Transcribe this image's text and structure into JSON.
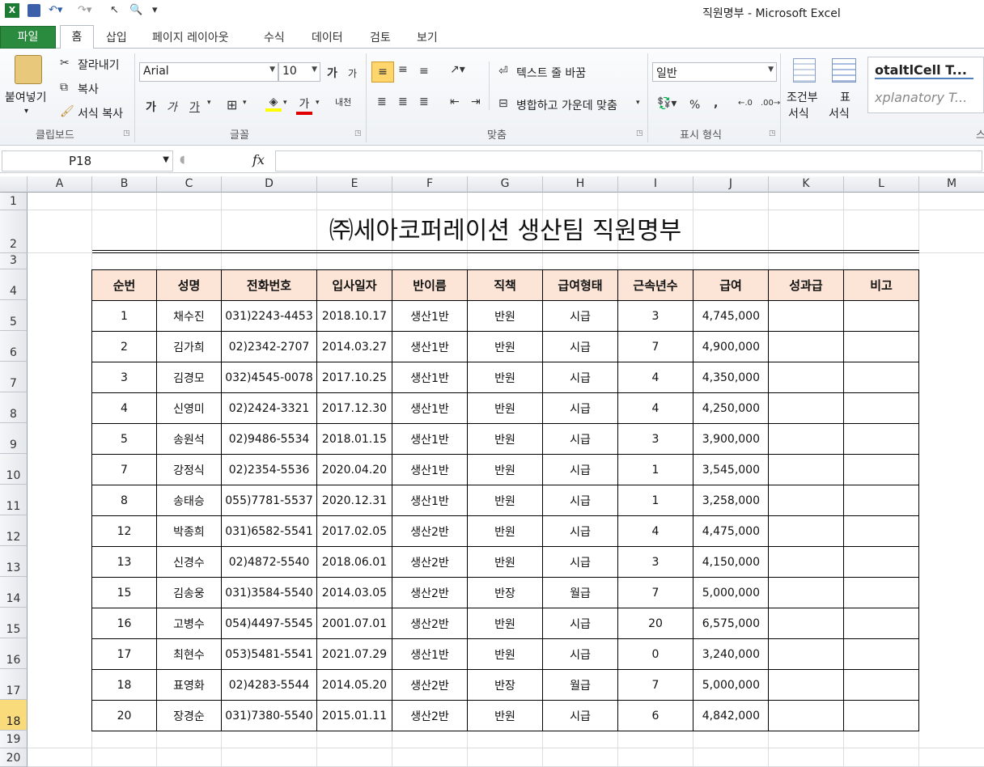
{
  "window": {
    "title": "직원명부  -  Microsoft Excel"
  },
  "quick_access": {
    "icons": [
      "excel-logo-icon",
      "save-icon",
      "undo-icon",
      "redo-icon",
      "pointer-icon",
      "print-preview-icon",
      "customize-qat-icon"
    ]
  },
  "tabs": [
    "파일",
    "홈",
    "삽입",
    "페이지 레이아웃",
    "수식",
    "데이터",
    "검토",
    "보기"
  ],
  "ribbon": {
    "clipboard": {
      "paste": "붙여넣기",
      "cut": "잘라내기",
      "copy": "복사",
      "format_painter": "서식 복사",
      "label": "클립보드"
    },
    "font": {
      "name": "Arial",
      "size": "10",
      "grow": "가",
      "shrink": "가",
      "bold": "가",
      "italic": "가",
      "underline": "가",
      "font_color": "가",
      "phonetic": "내천",
      "label": "글꼴"
    },
    "alignment": {
      "wrap_text": "텍스트 줄 바꿈",
      "merge_center": "병합하고 가운데 맞춤",
      "label": "맞춤"
    },
    "number": {
      "format": "일반",
      "percent": "%",
      "comma": ",",
      "label": "표시 형식"
    },
    "styles": {
      "conditional": "조건부",
      "conditional2": "서식",
      "table": "표",
      "table2": "서식",
      "style1": "otaltlCell T...",
      "style2": "xplanatory T...",
      "partial_label": "스"
    }
  },
  "formula_bar": {
    "name_box": "P18",
    "fx": "fx",
    "content": ""
  },
  "columns": [
    "A",
    "B",
    "C",
    "D",
    "E",
    "F",
    "G",
    "H",
    "I",
    "J",
    "K",
    "L",
    "M"
  ],
  "rows": [
    "1",
    "2",
    "3",
    "4",
    "5",
    "6",
    "7",
    "8",
    "9",
    "10",
    "11",
    "12",
    "13",
    "14",
    "15",
    "16",
    "17",
    "18",
    "19",
    "20"
  ],
  "selected_row": "18",
  "sheet": {
    "title": "㈜세아코퍼레이션 생산팀 직원명부",
    "headers": [
      "순번",
      "성명",
      "전화번호",
      "입사일자",
      "반이름",
      "직책",
      "급여형태",
      "근속년수",
      "급여",
      "성과급",
      "비고"
    ],
    "rows": [
      [
        "1",
        "채수진",
        "031)2243-4453",
        "2018.10.17",
        "생산1반",
        "반원",
        "시급",
        "3",
        "4,745,000",
        "",
        ""
      ],
      [
        "2",
        "김가희",
        "02)2342-2707",
        "2014.03.27",
        "생산1반",
        "반원",
        "시급",
        "7",
        "4,900,000",
        "",
        ""
      ],
      [
        "3",
        "김경모",
        "032)4545-0078",
        "2017.10.25",
        "생산1반",
        "반원",
        "시급",
        "4",
        "4,350,000",
        "",
        ""
      ],
      [
        "4",
        "신영미",
        "02)2424-3321",
        "2017.12.30",
        "생산1반",
        "반원",
        "시급",
        "4",
        "4,250,000",
        "",
        ""
      ],
      [
        "5",
        "송원석",
        "02)9486-5534",
        "2018.01.15",
        "생산1반",
        "반원",
        "시급",
        "3",
        "3,900,000",
        "",
        ""
      ],
      [
        "7",
        "강정식",
        "02)2354-5536",
        "2020.04.20",
        "생산1반",
        "반원",
        "시급",
        "1",
        "3,545,000",
        "",
        ""
      ],
      [
        "8",
        "송태승",
        "055)7781-5537",
        "2020.12.31",
        "생산1반",
        "반원",
        "시급",
        "1",
        "3,258,000",
        "",
        ""
      ],
      [
        "12",
        "박종희",
        "031)6582-5541",
        "2017.02.05",
        "생산2반",
        "반원",
        "시급",
        "4",
        "4,475,000",
        "",
        ""
      ],
      [
        "13",
        "신경수",
        "02)4872-5540",
        "2018.06.01",
        "생산2반",
        "반원",
        "시급",
        "3",
        "4,150,000",
        "",
        ""
      ],
      [
        "15",
        "김송웅",
        "031)3584-5540",
        "2014.03.05",
        "생산2반",
        "반장",
        "월급",
        "7",
        "5,000,000",
        "",
        ""
      ],
      [
        "16",
        "고병수",
        "054)4497-5545",
        "2001.07.01",
        "생산2반",
        "반원",
        "시급",
        "20",
        "6,575,000",
        "",
        ""
      ],
      [
        "17",
        "최현수",
        "053)5481-5541",
        "2021.07.29",
        "생산1반",
        "반원",
        "시급",
        "0",
        "3,240,000",
        "",
        ""
      ],
      [
        "18",
        "표영화",
        "02)4283-5544",
        "2014.05.20",
        "생산2반",
        "반장",
        "월급",
        "7",
        "5,000,000",
        "",
        ""
      ],
      [
        "20",
        "장경순",
        "031)7380-5540",
        "2015.01.11",
        "생산2반",
        "반원",
        "시급",
        "6",
        "4,842,000",
        "",
        ""
      ]
    ]
  },
  "colors": {
    "file_tab": "#2a8a3e",
    "header_fill": "#fce4d6",
    "selected_row": "#fadb7c"
  }
}
